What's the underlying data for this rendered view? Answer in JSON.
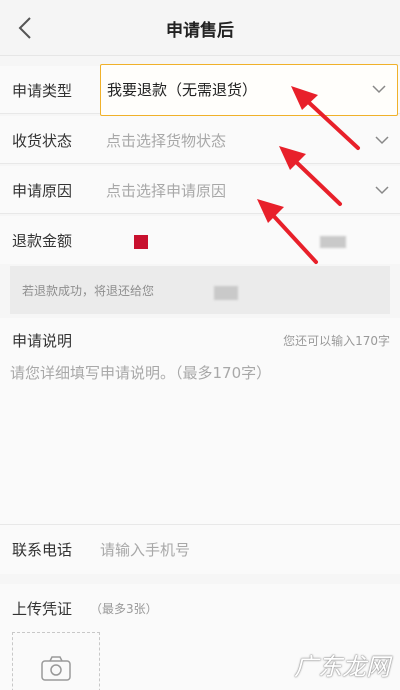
{
  "header": {
    "title": "申请售后"
  },
  "form": {
    "type": {
      "label": "申请类型",
      "value": "我要退款（无需退货）"
    },
    "goods_status": {
      "label": "收货状态",
      "placeholder": "点击选择货物状态"
    },
    "reason": {
      "label": "申请原因",
      "placeholder": "点击选择申请原因"
    },
    "amount": {
      "label": "退款金额"
    }
  },
  "notice": {
    "text": "若退款成功，将退还给您"
  },
  "description": {
    "title": "申请说明",
    "counter": "您还可以输入170字",
    "placeholder": "请您详细填写申请说明。（最多170字）"
  },
  "phone": {
    "label": "联系电话",
    "placeholder": "请输入手机号"
  },
  "upload": {
    "title": "上传凭证",
    "hint": "（最多3张）"
  },
  "watermark": {
    "text": "广东龙网"
  },
  "colors": {
    "highlight_border": "#f0b12a",
    "arrow_red": "#e8202a",
    "amount_mark": "#c8102e"
  },
  "icons": {
    "back": "chevron-left-icon",
    "dropdown": "chevron-down-icon",
    "upload": "camera-icon"
  }
}
